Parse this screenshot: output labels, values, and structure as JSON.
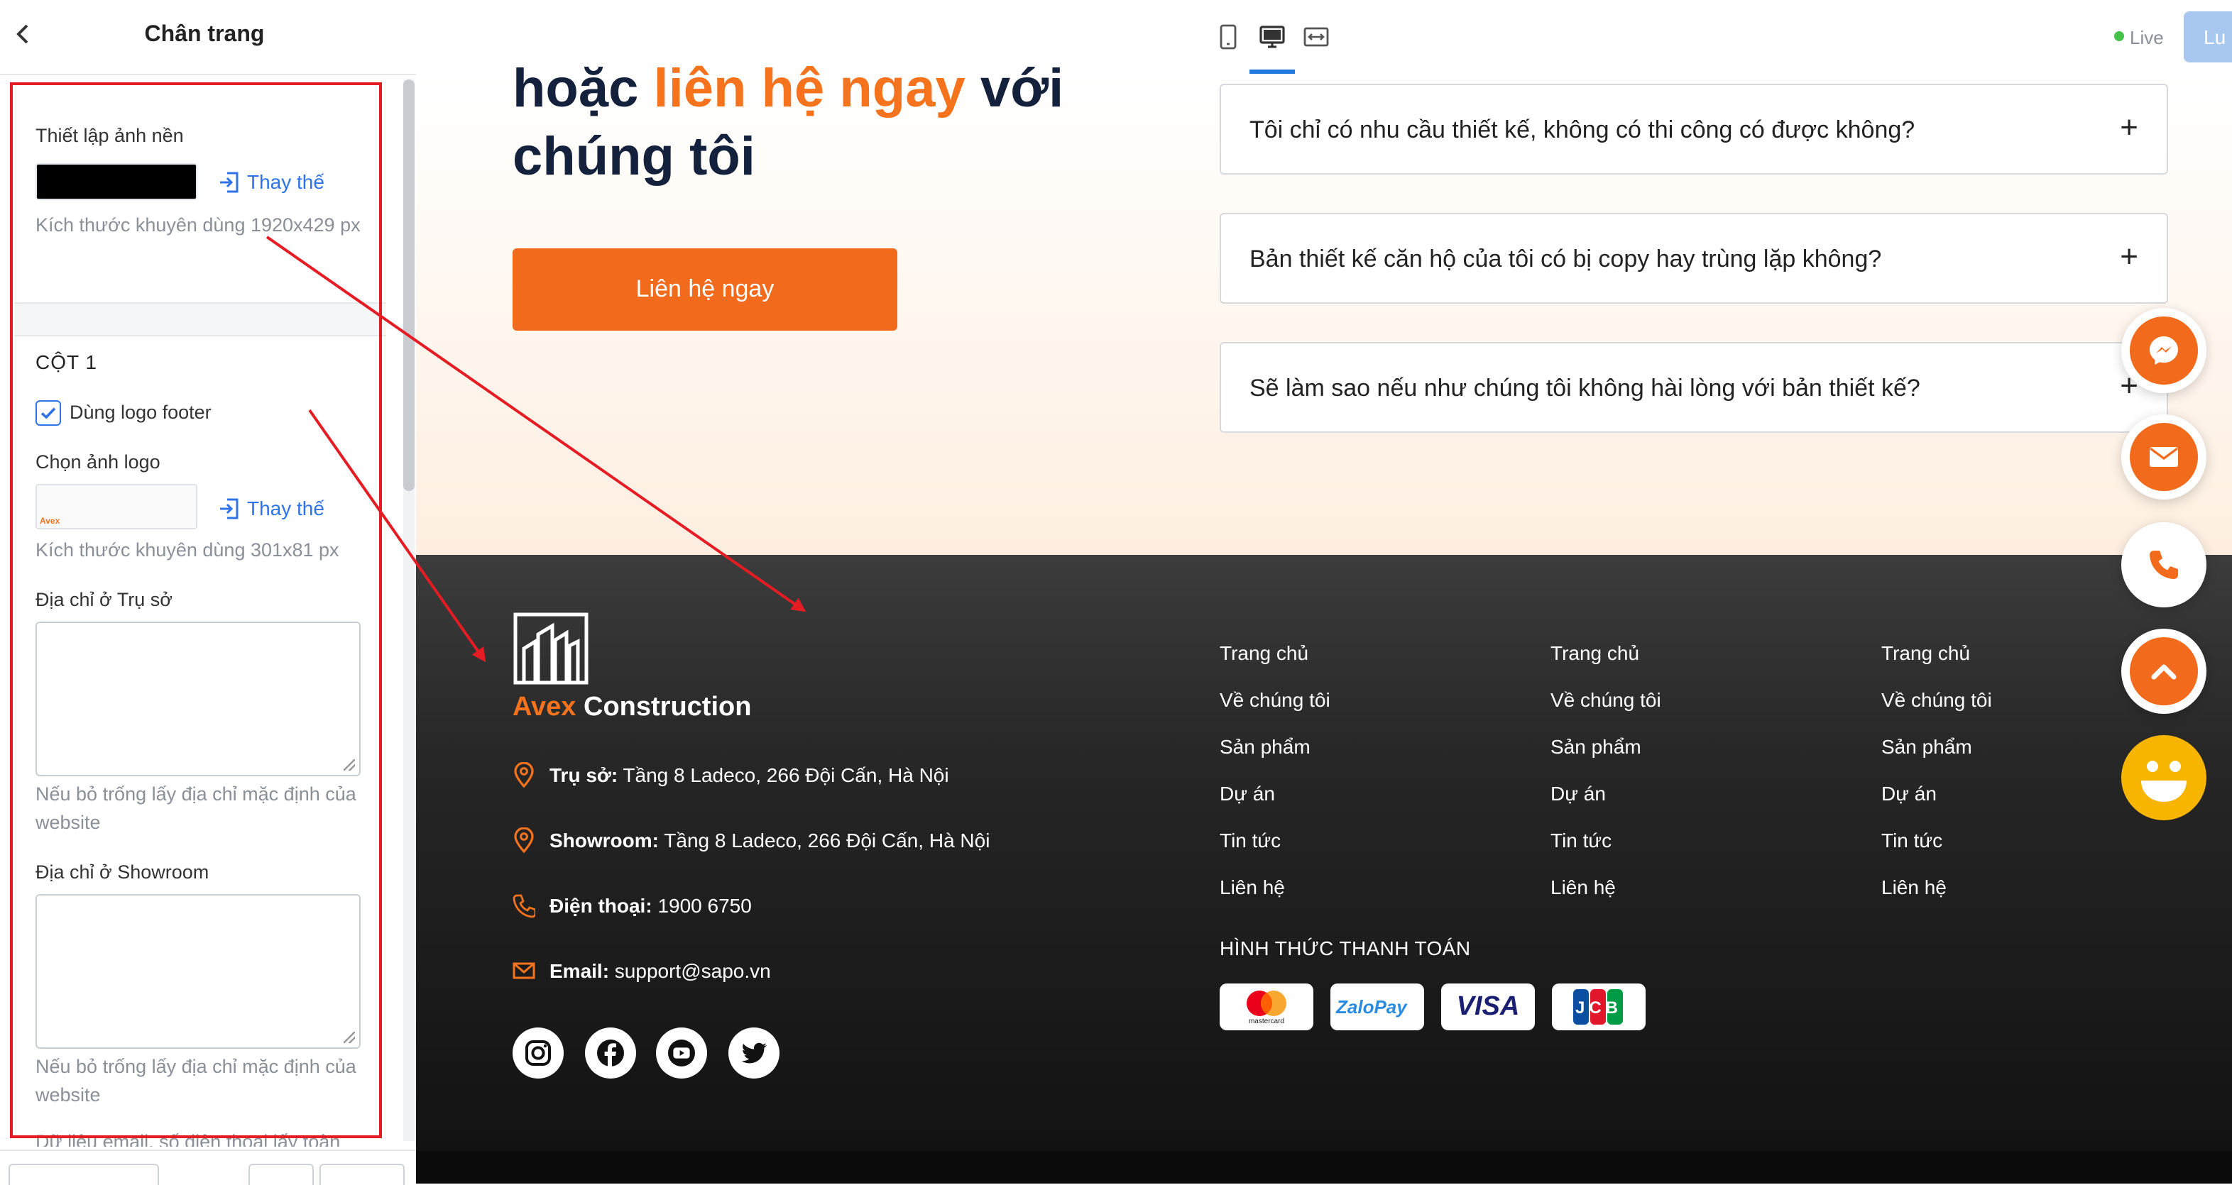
{
  "sidebar": {
    "title": "Chân trang",
    "background": {
      "label": "Thiết lập ảnh nền",
      "replace_label": "Thay thế",
      "hint": "Kích thước khuyên dùng 1920x429 px"
    },
    "column1": {
      "heading": "CỘT 1",
      "use_logo_label": "Dùng logo footer",
      "use_logo_checked": true,
      "logo_label": "Chọn ảnh logo",
      "logo_thumb_text": "Avex",
      "replace_label": "Thay thế",
      "logo_hint": "Kích thước khuyên dùng 301x81 px",
      "hq_address_label": "Địa chỉ ở Trụ sở",
      "hq_address_value": "",
      "hq_hint": "Nếu bỏ trống lấy địa chỉ mặc định của website",
      "showroom_label": "Địa chỉ ở Showroom",
      "showroom_value": "",
      "showroom_hint": "Nếu bỏ trống lấy địa chỉ mặc định của website",
      "cut_off_text": "Dữ liệu email, số điện thoại lấy toàn"
    }
  },
  "topbar": {
    "status": "Live",
    "save_label": "Lu",
    "devices": [
      "mobile-icon",
      "desktop-icon",
      "fullwidth-icon"
    ],
    "active_device": "desktop-icon"
  },
  "hero": {
    "line1_a": "hoặc ",
    "line1_highlight": "liên hệ ngay",
    "line1_b": " với",
    "line2": "chúng tôi",
    "cta_label": "Liên hệ ngay"
  },
  "faq": [
    {
      "question": "Tôi chỉ có nhu cầu thiết kế, không có thi công có được không?"
    },
    {
      "question": "Bản thiết kế căn hộ của tôi có bị copy hay trùng lặp không?"
    },
    {
      "question": "Sẽ làm sao nếu như chúng tôi không hài lòng với bản thiết kế?"
    }
  ],
  "footer": {
    "brand_a": "Avex",
    "brand_b": " Construction",
    "contacts": [
      {
        "label": "Trụ sở:",
        "value": " Tầng 8 Ladeco, 266 Đội Cấn, Hà Nội"
      },
      {
        "label": "Showroom:",
        "value": " Tầng 8 Ladeco, 266 Đội Cấn, Hà Nội"
      },
      {
        "label": "Điện thoại:",
        "value": " 1900 6750"
      },
      {
        "label": "Email:",
        "value": " support@sapo.vn"
      }
    ],
    "nav_columns": [
      [
        "Trang chủ",
        "Về chúng tôi",
        "Sản phẩm",
        "Dự án",
        "Tin tức",
        "Liên hệ"
      ],
      [
        "Trang chủ",
        "Về chúng tôi",
        "Sản phẩm",
        "Dự án",
        "Tin tức",
        "Liên hệ"
      ],
      [
        "Trang chủ",
        "Về chúng tôi",
        "Sản phẩm",
        "Dự án",
        "Tin tức",
        "Liên hệ"
      ]
    ],
    "payment_title": "HÌNH THỨC THANH TOÁN",
    "payment_methods": [
      {
        "name": "mastercard",
        "text": "mastercard"
      },
      {
        "name": "zalopay",
        "text": "ZaloPay"
      },
      {
        "name": "visa",
        "text": "VISA"
      },
      {
        "name": "jcb",
        "text": "JCB"
      }
    ],
    "socials": [
      "instagram-icon",
      "facebook-icon",
      "youtube-icon",
      "twitter-icon"
    ]
  },
  "floating_actions": [
    "messenger-icon",
    "mail-icon",
    "phone-icon",
    "scroll-top-icon",
    "smiley-icon"
  ],
  "colors": {
    "accent": "#f26a1b",
    "link": "#2f73e8",
    "annotation": "#e51c23",
    "dark_text": "#14213d"
  }
}
